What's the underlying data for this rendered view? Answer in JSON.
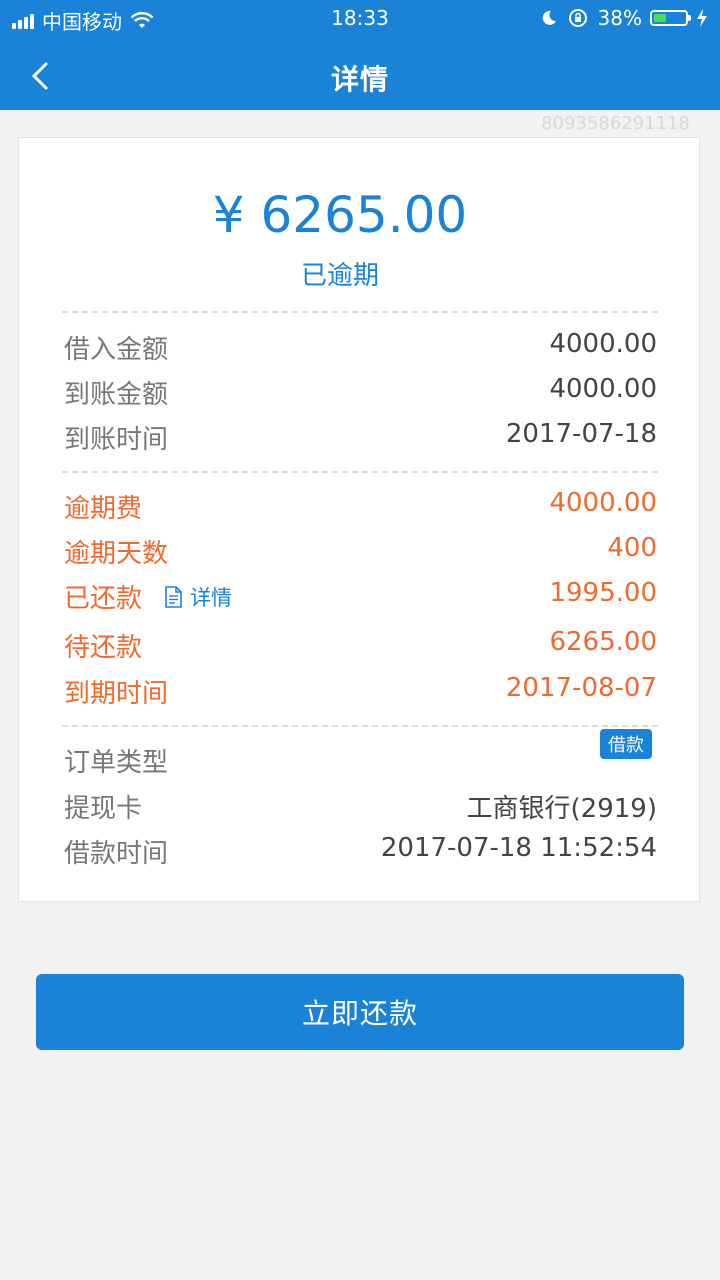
{
  "status_bar": {
    "carrier": "中国移动",
    "time": "18:33",
    "battery": "38%",
    "battery_level": 0.38
  },
  "nav": {
    "title": "详情"
  },
  "order_id": "8093586291118",
  "summary": {
    "amount": "¥ 6265.00",
    "status": "已逾期"
  },
  "loan_info": [
    {
      "label": "借入金额",
      "value": "4000.00"
    },
    {
      "label": "到账金额",
      "value": "4000.00"
    },
    {
      "label": "到账时间",
      "value": "2017-07-18"
    }
  ],
  "repayment_info": {
    "overdue_fee": {
      "label": "逾期费",
      "value": "4000.00"
    },
    "overdue_days": {
      "label": "逾期天数",
      "value": "400"
    },
    "repaid": {
      "label": "已还款",
      "link": "详情",
      "value": "1995.00"
    },
    "pending": {
      "label": "待还款",
      "value": "6265.00"
    },
    "due_date": {
      "label": "到期时间",
      "value": "2017-08-07"
    }
  },
  "order_info": {
    "type": {
      "label": "订单类型",
      "tag": "借款"
    },
    "card": {
      "label": "提现卡",
      "value": "工商银行(2919)"
    },
    "time": {
      "label": "借款时间",
      "value": "2017-07-18 11:52:54"
    }
  },
  "action": {
    "label": "立即还款"
  },
  "colors": {
    "primary": "#1a82d7",
    "warning": "#ee6a2d"
  }
}
